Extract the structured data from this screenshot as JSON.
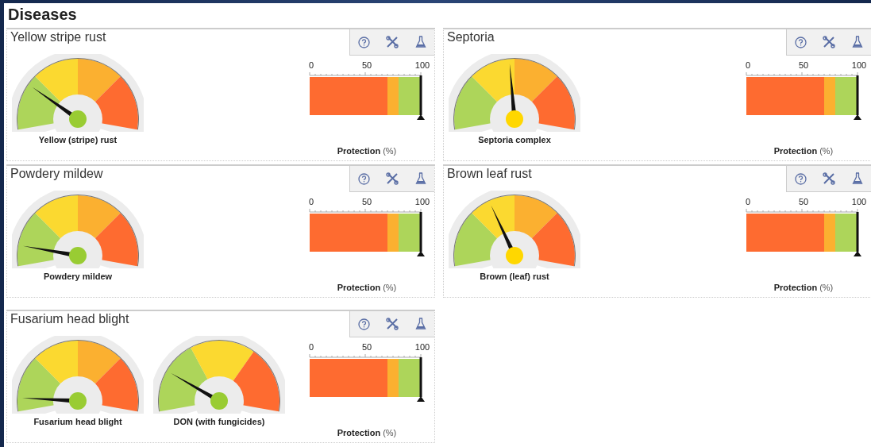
{
  "page_title": "Diseases",
  "panels": [
    {
      "title": "Yellow stripe rust",
      "gauges": [
        {
          "label": "Yellow (stripe) rust",
          "kind": "four-band",
          "level": 0.225,
          "color": "#99cc33"
        }
      ],
      "meter": {
        "ticks": [
          "0",
          "50",
          "100"
        ],
        "level": 1,
        "label": "**Protection** (%)"
      }
    },
    {
      "title": "Septoria",
      "gauges": [
        {
          "label": "Septoria complex",
          "kind": "four-band",
          "level": 0.475,
          "color": "#ffd700"
        }
      ],
      "meter": {
        "ticks": [
          "0",
          "50",
          "100"
        ],
        "level": 1,
        "label": "**Protection** (%)"
      }
    },
    {
      "title": "Powdery mildew",
      "gauges": [
        {
          "label": "Powdery mildew",
          "kind": "four-band",
          "level": 0.1,
          "color": "#99cc33"
        }
      ],
      "meter": {
        "ticks": [
          "0",
          "50",
          "100"
        ],
        "level": 1,
        "label": "**Protection** (%)"
      }
    },
    {
      "title": "Brown leaf rust",
      "gauges": [
        {
          "label": "Brown (leaf) rust",
          "kind": "four-band",
          "level": 0.375,
          "color": "#ffd700"
        }
      ],
      "meter": {
        "ticks": [
          "0",
          "50",
          "100"
        ],
        "level": 1,
        "label": "**Protection** (%)"
      }
    },
    {
      "title": "Fusarium head blight",
      "gauges": [
        {
          "label": "Fusarium head blight",
          "kind": "four-band",
          "level": 0.065,
          "color": "#99cc33"
        },
        {
          "label": "DON (with fungicides)",
          "kind": "three-band",
          "level": 0.2,
          "color": "#99cc33"
        }
      ],
      "meter": {
        "ticks": [
          "0",
          "50",
          "100"
        ],
        "level": 1,
        "label": "**Protection** (%)"
      }
    }
  ]
}
